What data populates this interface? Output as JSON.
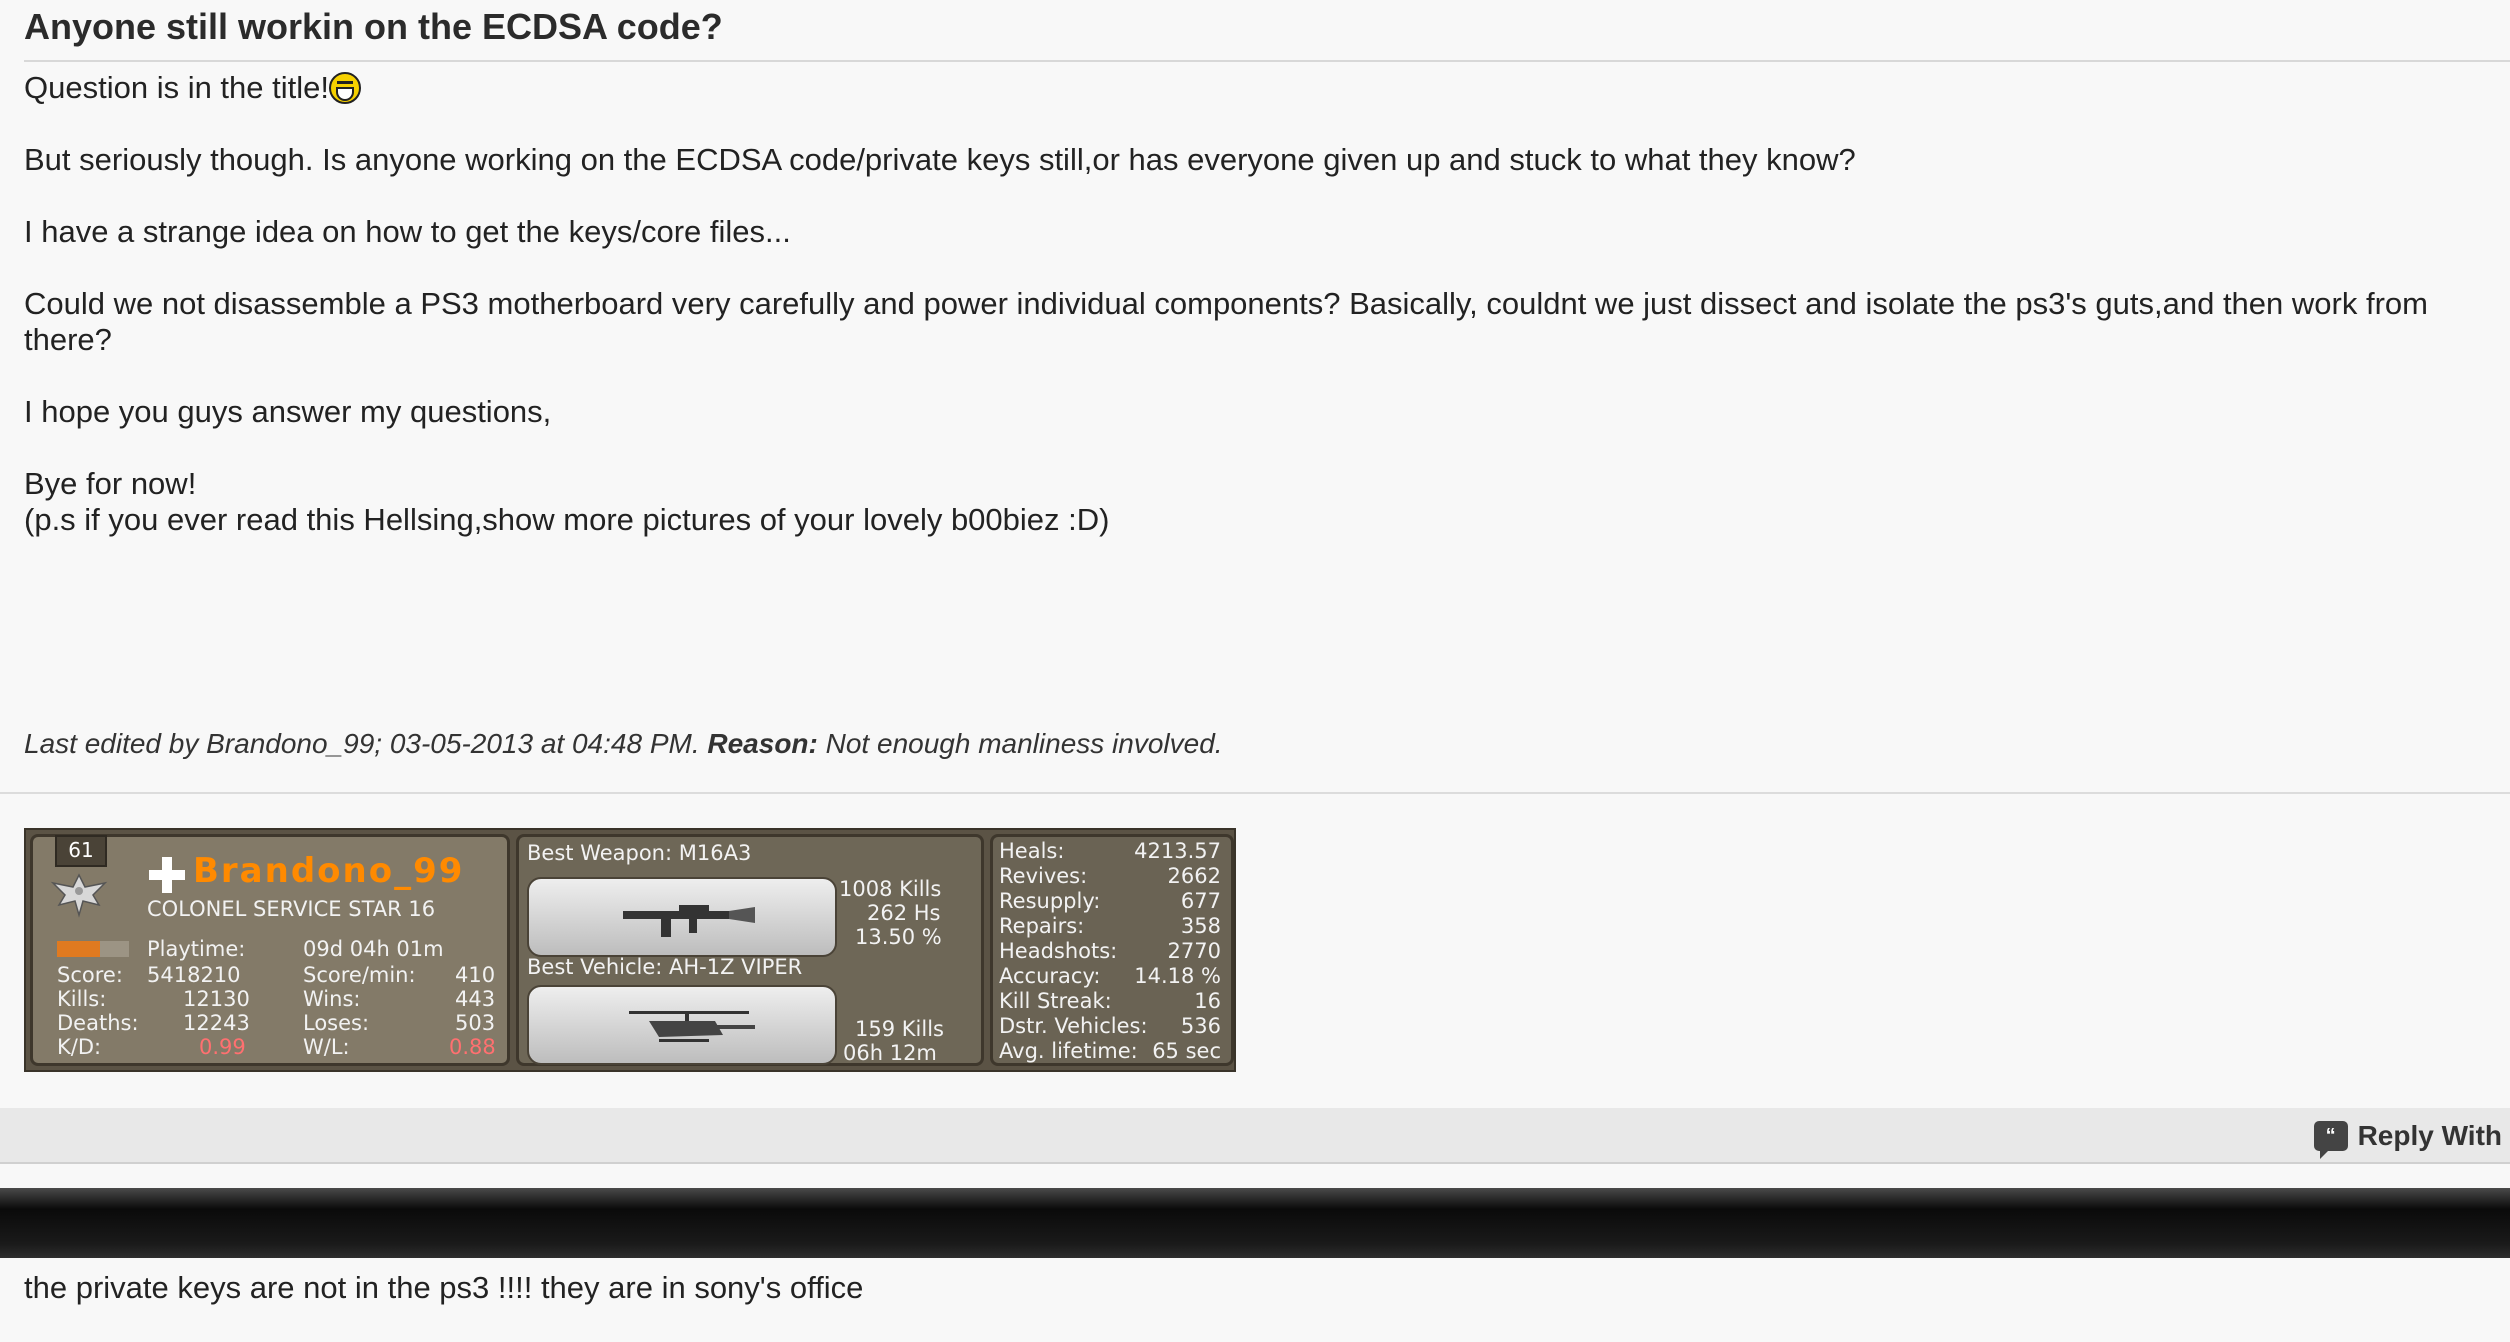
{
  "post": {
    "title": "Anyone still workin on the ECDSA code?",
    "lines": {
      "l1": "Question is in the title!",
      "l2": "But seriously though. Is anyone working on the ECDSA code/private keys still,or has everyone given up and stuck to what they know?",
      "l3": "I have a strange idea on how to get the keys/core files...",
      "l4": "Could we not disassemble a PS3 motherboard very carefully and power individual components? Basically, couldnt we just dissect and isolate the ps3's guts,and then work from there?",
      "l5": "I hope you guys answer my questions,",
      "l6": "Bye for now!",
      "l7": "(p.s if you ever read this Hellsing,show more pictures of your lovely b00biez :D)"
    },
    "smiley_icon": "laughing-smiley-icon",
    "last_edited_prefix": "Last edited by Brandono_99; 03-05-2013 at 04:48 PM.",
    "reason_label": "Reason:",
    "reason_text": "Not enough manliness involved."
  },
  "signature": {
    "rank_number": "61",
    "player_name": "Brandono_99",
    "rank_title": "COLONEL SERVICE STAR 16",
    "playtime_label": "Playtime:",
    "playtime_value": "09d 04h 01m",
    "score_label": "Score:",
    "score_value": "5418210",
    "scoremin_label": "Score/min:",
    "scoremin_value": "410",
    "kills_label": "Kills:",
    "kills_value": "12130",
    "wins_label": "Wins:",
    "wins_value": "443",
    "deaths_label": "Deaths:",
    "deaths_value": "12243",
    "loses_label": "Loses:",
    "loses_value": "503",
    "kd_label": "K/D:",
    "kd_value": "0.99",
    "wl_label": "W/L:",
    "wl_value": "0.88",
    "rank_progress": 0.6,
    "best_weapon": "Best Weapon: M16A3",
    "weapon_kills": "1008 Kills",
    "weapon_hs": "262 Hs",
    "weapon_pct": "13.50 %",
    "best_vehicle": "Best Vehicle: AH-1Z VIPER",
    "vehicle_kills": "159 Kills",
    "vehicle_time": "06h 12m",
    "stats": [
      {
        "label": "Heals:",
        "value": "4213.57"
      },
      {
        "label": "Revives:",
        "value": "2662"
      },
      {
        "label": "Resupply:",
        "value": "677"
      },
      {
        "label": "Repairs:",
        "value": "358"
      },
      {
        "label": "Headshots:",
        "value": "2770"
      },
      {
        "label": "Accuracy:",
        "value": "14.18 %"
      },
      {
        "label": "Kill Streak:",
        "value": "16"
      },
      {
        "label": "Dstr. Vehicles:",
        "value": "536"
      },
      {
        "label": "Avg. lifetime:",
        "value": "65 sec"
      }
    ]
  },
  "reply_bar": {
    "reply_label": "Reply With",
    "reply_icon": "quote-bubble-icon"
  },
  "next_post": {
    "text": "the private keys are not in the ps3 !!!! they are in sony's office"
  },
  "colors": {
    "player_name": "#ff8a00",
    "negative_stat": "#ff7070"
  }
}
